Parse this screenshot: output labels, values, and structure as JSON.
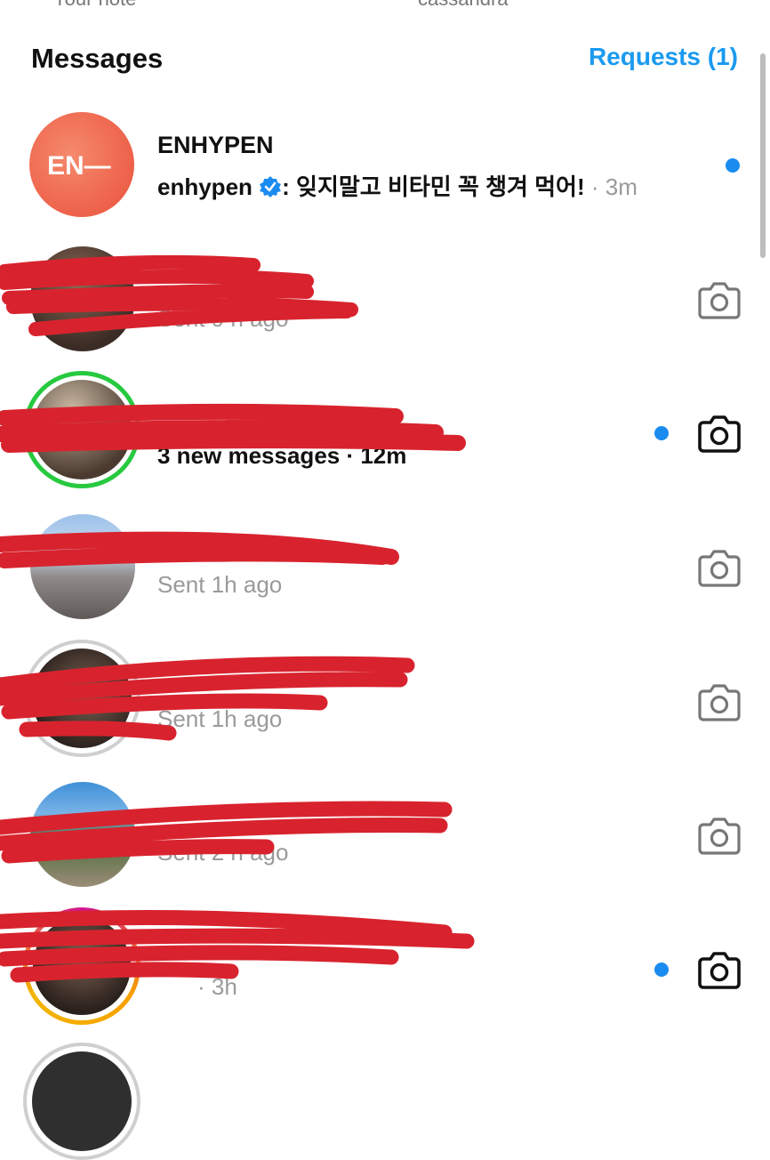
{
  "notes_strip": {
    "items": [
      "Your note",
      "cassandra"
    ]
  },
  "header": {
    "title": "Messages",
    "requests_label": "Requests (1)"
  },
  "threads": [
    {
      "name": "ENHYPEN",
      "preview_sender": "enhypen",
      "preview_text": ": 잊지말고 비타민 꼭 챙겨 먹어!",
      "time": " · 3m",
      "unread": true,
      "avatar_logo": "EN—",
      "verified_icon": "verified-badge-icon"
    },
    {
      "preview": "Sent 9 h ago",
      "unread": false,
      "camera_icon": "camera-icon"
    },
    {
      "preview": "3 new messages · 12m",
      "unread": true,
      "camera_icon": "camera-icon"
    },
    {
      "preview": "Sent 1h ago",
      "unread": false,
      "camera_icon": "camera-icon"
    },
    {
      "preview": "Sent 1h ago",
      "unread": false,
      "camera_icon": "camera-icon"
    },
    {
      "preview": "Sent 2 h ago",
      "unread": false,
      "camera_icon": "camera-icon"
    },
    {
      "preview": "· 3h",
      "unread": true,
      "camera_icon": "camera-icon"
    }
  ],
  "colors": {
    "accent": "#1a9af0",
    "unread_dot": "#1a8cf0",
    "redaction": "#d8232e",
    "enhypen_avatar": "#f06a4f"
  }
}
